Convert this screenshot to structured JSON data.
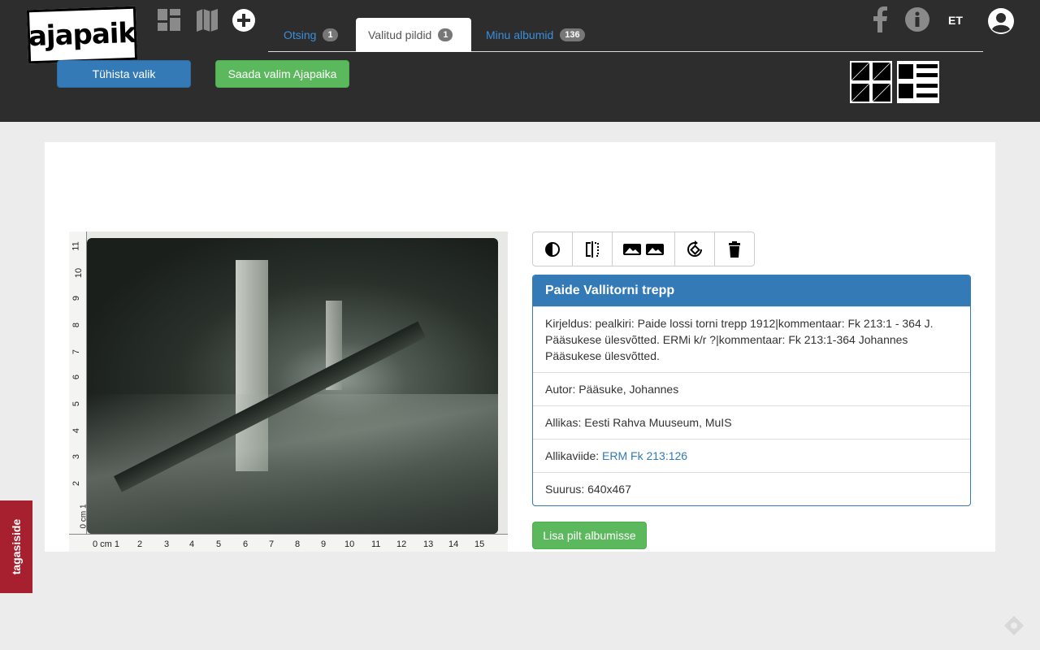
{
  "header": {
    "logo_text": "ajapaik",
    "tabs": [
      {
        "label": "Otsing",
        "count": "1"
      },
      {
        "label": "Valitud pildid",
        "count": "1"
      },
      {
        "label": "Minu albumid",
        "count": "136"
      }
    ],
    "language": "ET",
    "buttons": {
      "clear_selection": "Tühista valik",
      "send_selection": "Saada valim Ajapaika"
    }
  },
  "photo": {
    "ruler_bottom": [
      "0 cm 1",
      "2",
      "3",
      "4",
      "5",
      "6",
      "7",
      "8",
      "9",
      "10",
      "11",
      "12",
      "13",
      "14",
      "15"
    ],
    "ruler_left": [
      "0 cm 1",
      "2",
      "3",
      "4",
      "5",
      "6",
      "7",
      "8",
      "9",
      "10",
      "11"
    ]
  },
  "info": {
    "title": "Paide Vallitorni trepp",
    "description": "Kirjeldus: pealkiri: Paide lossi torni trepp 1912|kommentaar: Fk 213:1 - 364 J. Pääsukese ülesvõtted. ERMi k/r ?|kommentaar: Fk 213:1-364 Johannes Pääsukese ülesvõtted.",
    "author": "Autor: Pääsuke, Johannes",
    "source": "Allikas: Eesti Rahva Muuseum, MuIS",
    "source_ref_label": "Allikaviide: ",
    "source_ref_link": "ERM Fk 213:126",
    "size": "Suurus: 640x467",
    "add_to_album": "Lisa pilt albumisse"
  },
  "feedback_label": "tagasiside",
  "colors": {
    "header_bg": "#2d2d2d",
    "primary": "#337ab7",
    "success": "#5cb85c",
    "feedback": "#a7202f"
  }
}
